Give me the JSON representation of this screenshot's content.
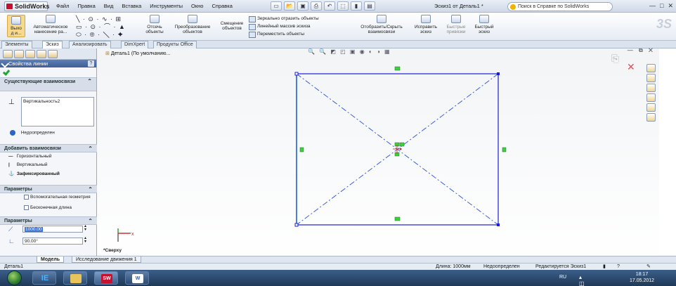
{
  "app": {
    "logo": "SolidWorks",
    "menu": [
      "Файл",
      "Правка",
      "Вид",
      "Вставка",
      "Инструменты",
      "Окно",
      "Справка"
    ],
    "document_title": "Эскиз1 от Деталь1 *",
    "help_search_placeholder": "Поиск в Справке по SolidWorks",
    "window_controls": [
      "—",
      "□",
      "✕"
    ]
  },
  "commandbar": {
    "exit_sketch": "Выхо д и...",
    "auto_dimension": "Автоматическое нанесение ра...",
    "trim": "Отсечь объекты",
    "convert": "Преобразование объектов",
    "offset": "Смещение объектов",
    "mirror": "Зеркально отразить объекты",
    "linear_pattern": "Линейный массив эскиза",
    "move": "Переместить объекты",
    "display_relations": "Отобразить/Скрыть взаимосвязи",
    "repair": "Исправить эскиз",
    "quick_snaps": "Быстрые привязки",
    "rapid_sketch": "Быстрый эскиз"
  },
  "tabs": [
    "Элементы",
    "Эскиз",
    "Анализировать",
    "DimXpert",
    "Продукты Office"
  ],
  "active_tab": "Эскиз",
  "property_manager": {
    "title": "Свойства линии",
    "help_icon_label": "?",
    "existing_relations_header": "Существующие взаимосвязи",
    "existing_relations": [
      "Вертикальность2"
    ],
    "status": "Недоопределен",
    "add_relations_header": "Добавить взаимосвязи",
    "add_relations": [
      "Горизонтальный",
      "Вертикальный",
      "Зафиксированный"
    ],
    "options_header": "Параметры",
    "construction_label": "Вспомогательная геометрия",
    "infinite_label": "Бесконечная длина",
    "parameters_header": "Параметры",
    "length_value": "1000.00",
    "angle_value": "90.00°"
  },
  "graphics": {
    "tree_item": "Деталь1 (По умолчанию...",
    "view_label": "*Сверху",
    "view_toolbar": "🔍 🔍 ◩ ◰ ▣ ◉ ◐ ◑ ▦"
  },
  "bottom_tabs": [
    "Модель",
    "Исследование движения 1"
  ],
  "statusbar": {
    "left": "Деталь1",
    "length": "Длина: 1000мм",
    "defined": "Недоопределен",
    "editing": "Редактируется Эскиз1"
  },
  "taskbar": {
    "language": "RU",
    "time": "18:17",
    "date": "17.05.2012",
    "apps": [
      "IE",
      "Folder",
      "SW",
      "W"
    ]
  },
  "colors": {
    "sketch_blue": "#1c1cd8",
    "relation_green": "#3bd23b",
    "accent_red": "#c8102e"
  }
}
